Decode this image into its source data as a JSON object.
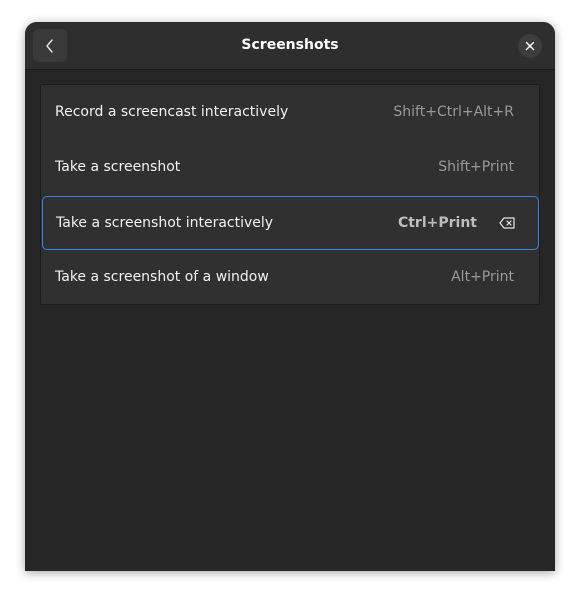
{
  "window": {
    "title": "Screenshots"
  },
  "shortcuts": [
    {
      "label": "Record a screencast interactively",
      "accel": "Shift+Ctrl+Alt+R"
    },
    {
      "label": "Take a screenshot",
      "accel": "Shift+Print"
    },
    {
      "label": "Take a screenshot interactively",
      "accel": "Ctrl+Print",
      "selected": true
    },
    {
      "label": "Take a screenshot of a window",
      "accel": "Alt+Print"
    }
  ],
  "icons": {
    "back": "go-back-icon",
    "close": "close-icon",
    "clear": "backspace-clear-icon"
  },
  "colors": {
    "window_bg": "#262626",
    "list_bg": "#303030",
    "accent": "#3584e4"
  }
}
